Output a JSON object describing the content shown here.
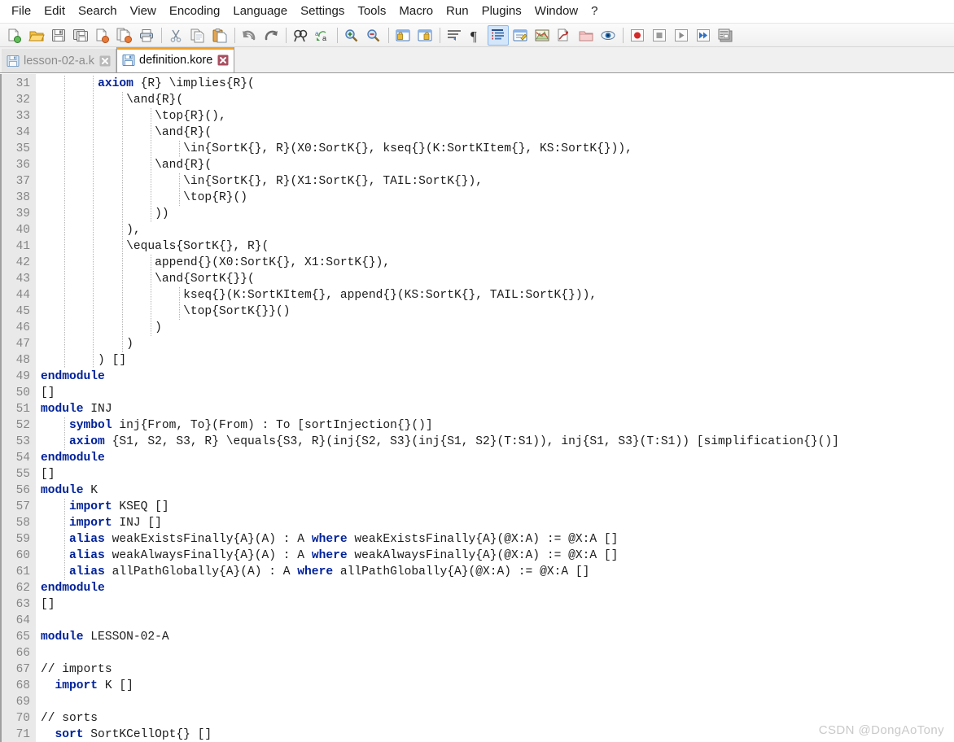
{
  "menu": {
    "items": [
      {
        "label": "File",
        "name": "menu-file"
      },
      {
        "label": "Edit",
        "name": "menu-edit"
      },
      {
        "label": "Search",
        "name": "menu-search"
      },
      {
        "label": "View",
        "name": "menu-view"
      },
      {
        "label": "Encoding",
        "name": "menu-encoding"
      },
      {
        "label": "Language",
        "name": "menu-language"
      },
      {
        "label": "Settings",
        "name": "menu-settings"
      },
      {
        "label": "Tools",
        "name": "menu-tools"
      },
      {
        "label": "Macro",
        "name": "menu-macro"
      },
      {
        "label": "Run",
        "name": "menu-run"
      },
      {
        "label": "Plugins",
        "name": "menu-plugins"
      },
      {
        "label": "Window",
        "name": "menu-window"
      },
      {
        "label": "?",
        "name": "menu-help"
      }
    ]
  },
  "toolbar": {
    "buttons": [
      {
        "icon": "new-file-icon"
      },
      {
        "icon": "open-file-icon"
      },
      {
        "icon": "save-icon"
      },
      {
        "icon": "save-all-icon"
      },
      {
        "icon": "close-file-icon"
      },
      {
        "icon": "close-all-files-icon"
      },
      {
        "icon": "print-icon"
      },
      {
        "icon": "separator"
      },
      {
        "icon": "cut-icon"
      },
      {
        "icon": "copy-icon"
      },
      {
        "icon": "paste-icon"
      },
      {
        "icon": "separator"
      },
      {
        "icon": "undo-icon"
      },
      {
        "icon": "redo-icon"
      },
      {
        "icon": "separator"
      },
      {
        "icon": "find-icon"
      },
      {
        "icon": "replace-icon"
      },
      {
        "icon": "separator"
      },
      {
        "icon": "zoom-in-icon"
      },
      {
        "icon": "zoom-out-icon"
      },
      {
        "icon": "separator"
      },
      {
        "icon": "sync-vertical-scroll-icon"
      },
      {
        "icon": "sync-horizontal-scroll-icon"
      },
      {
        "icon": "separator"
      },
      {
        "icon": "word-wrap-icon"
      },
      {
        "icon": "show-all-characters-icon"
      },
      {
        "icon": "indent-guide-icon"
      },
      {
        "icon": "user-defined-language-icon"
      },
      {
        "icon": "document-map-icon"
      },
      {
        "icon": "function-list-icon"
      },
      {
        "icon": "folder-as-workspace-icon"
      },
      {
        "icon": "monitoring-icon"
      },
      {
        "icon": "separator"
      },
      {
        "icon": "record-macro-icon"
      },
      {
        "icon": "stop-macro-icon"
      },
      {
        "icon": "play-macro-icon"
      },
      {
        "icon": "run-macro-multiple-icon"
      },
      {
        "icon": "run-icon"
      }
    ]
  },
  "tabs": [
    {
      "label": "lesson-02-a.k",
      "active": false,
      "name": "tab-lesson-02-a-k"
    },
    {
      "label": "definition.kore",
      "active": true,
      "name": "tab-definition-kore"
    }
  ],
  "editor": {
    "first_line_number": 31,
    "lines": [
      {
        "n": 31,
        "text": "        axiom {R} \\implies{R}("
      },
      {
        "n": 32,
        "text": "            \\and{R}("
      },
      {
        "n": 33,
        "text": "                \\top{R}(),"
      },
      {
        "n": 34,
        "text": "                \\and{R}("
      },
      {
        "n": 35,
        "text": "                    \\in{SortK{}, R}(X0:SortK{}, kseq{}(K:SortKItem{}, KS:SortK{})),"
      },
      {
        "n": 36,
        "text": "                \\and{R}("
      },
      {
        "n": 37,
        "text": "                    \\in{SortK{}, R}(X1:SortK{}, TAIL:SortK{}),"
      },
      {
        "n": 38,
        "text": "                    \\top{R}()"
      },
      {
        "n": 39,
        "text": "                ))"
      },
      {
        "n": 40,
        "text": "            ),"
      },
      {
        "n": 41,
        "text": "            \\equals{SortK{}, R}("
      },
      {
        "n": 42,
        "text": "                append{}(X0:SortK{}, X1:SortK{}),"
      },
      {
        "n": 43,
        "text": "                \\and{SortK{}}("
      },
      {
        "n": 44,
        "text": "                    kseq{}(K:SortKItem{}, append{}(KS:SortK{}, TAIL:SortK{})),"
      },
      {
        "n": 45,
        "text": "                    \\top{SortK{}}()"
      },
      {
        "n": 46,
        "text": "                )"
      },
      {
        "n": 47,
        "text": "            )"
      },
      {
        "n": 48,
        "text": "        ) []"
      },
      {
        "n": 49,
        "text": "endmodule"
      },
      {
        "n": 50,
        "text": "[]"
      },
      {
        "n": 51,
        "text": "module INJ"
      },
      {
        "n": 52,
        "text": "    symbol inj{From, To}(From) : To [sortInjection{}()]"
      },
      {
        "n": 53,
        "text": "    axiom {S1, S2, S3, R} \\equals{S3, R}(inj{S2, S3}(inj{S1, S2}(T:S1)), inj{S1, S3}(T:S1)) [simplification{}()]"
      },
      {
        "n": 54,
        "text": "endmodule"
      },
      {
        "n": 55,
        "text": "[]"
      },
      {
        "n": 56,
        "text": "module K"
      },
      {
        "n": 57,
        "text": "    import KSEQ []"
      },
      {
        "n": 58,
        "text": "    import INJ []"
      },
      {
        "n": 59,
        "text": "    alias weakExistsFinally{A}(A) : A where weakExistsFinally{A}(@X:A) := @X:A []"
      },
      {
        "n": 60,
        "text": "    alias weakAlwaysFinally{A}(A) : A where weakAlwaysFinally{A}(@X:A) := @X:A []"
      },
      {
        "n": 61,
        "text": "    alias allPathGlobally{A}(A) : A where allPathGlobally{A}(@X:A) := @X:A []"
      },
      {
        "n": 62,
        "text": "endmodule"
      },
      {
        "n": 63,
        "text": "[]"
      },
      {
        "n": 64,
        "text": ""
      },
      {
        "n": 65,
        "text": "module LESSON-02-A"
      },
      {
        "n": 66,
        "text": ""
      },
      {
        "n": 67,
        "text": "// imports"
      },
      {
        "n": 68,
        "text": "  import K []"
      },
      {
        "n": 69,
        "text": ""
      },
      {
        "n": 70,
        "text": "// sorts"
      },
      {
        "n": 71,
        "text": "  sort SortKCellOpt{} []"
      }
    ],
    "keywords": [
      "axiom",
      "module",
      "endmodule",
      "symbol",
      "import",
      "alias",
      "where",
      "sort"
    ]
  },
  "watermark": "CSDN @DongAoTony",
  "colors": {
    "keyword": "#00229a",
    "active_tab_accent": "#f0a02a",
    "gutter_bg": "#e9e9e9",
    "gutter_text": "#868686",
    "editor_bg": "#ffffff",
    "toolbar_bg": "#f4f4f4"
  }
}
